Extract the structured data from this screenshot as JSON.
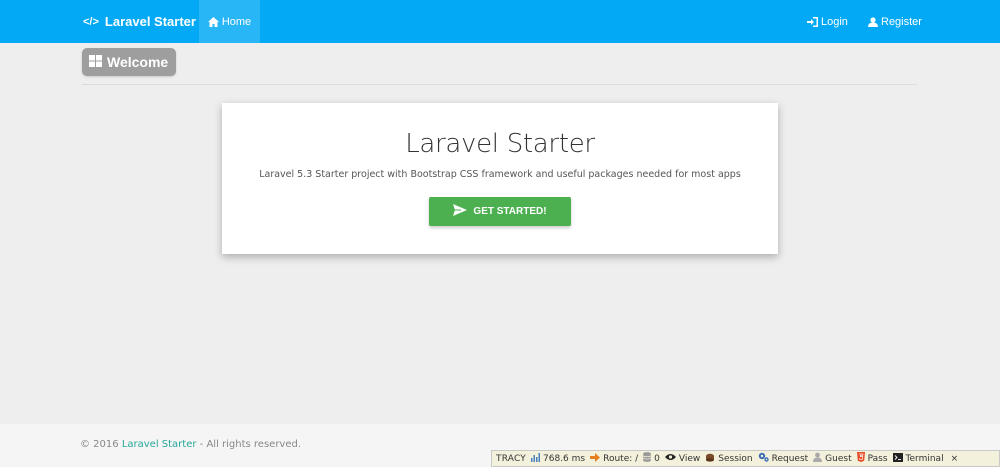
{
  "navbar": {
    "brand_icon": "</>",
    "brand": "Laravel Starter",
    "home": "Home",
    "login": "Login",
    "register": "Register"
  },
  "welcome": {
    "label": "Welcome"
  },
  "card": {
    "title": "Laravel Starter",
    "subtitle": "Laravel 5.3 Starter project with Bootstrap CSS framework and useful packages needed for most apps",
    "cta": "GET STARTED!"
  },
  "footer": {
    "prefix": "© 2016 ",
    "link": "Laravel Starter",
    "suffix": " - All rights reserved."
  },
  "tracy": {
    "brand": "TRACY",
    "time": "768.6 ms",
    "route": "Route: /",
    "queries": "0",
    "view": "View",
    "session": "Session",
    "request": "Request",
    "guest": "Guest",
    "pass": "Pass",
    "terminal": "Terminal",
    "close": "×"
  },
  "colors": {
    "navbar": "#03a9f4",
    "navbar_active": "#29b6f6",
    "cta": "#4caf50",
    "badge": "#9e9e9e",
    "link": "#26a69a"
  }
}
